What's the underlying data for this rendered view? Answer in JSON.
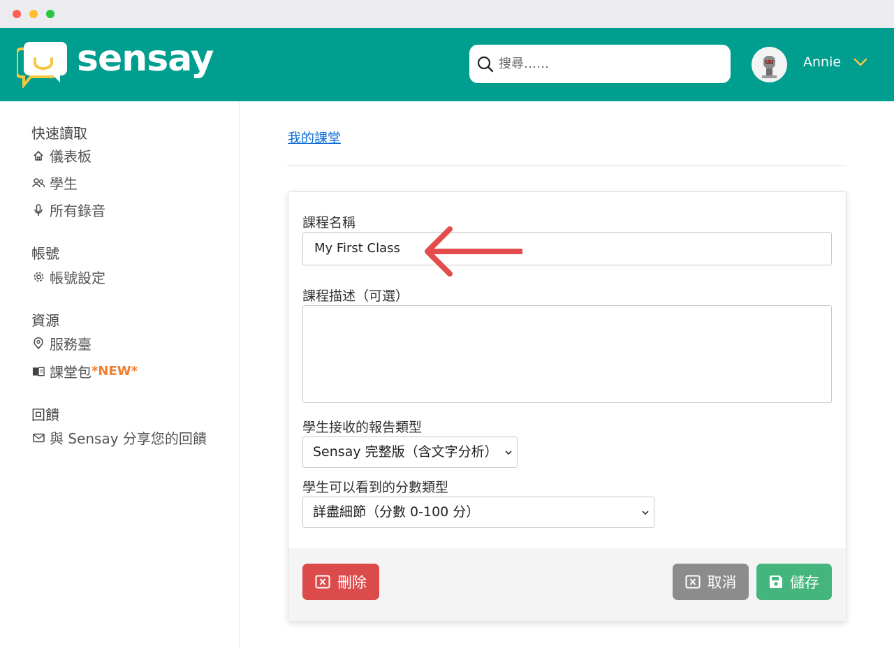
{
  "app": {
    "brand": "sensay",
    "colors": {
      "header": "#009e8f",
      "danger": "#dc4b4b",
      "neutral": "#8c8c8c",
      "success": "#44b57c",
      "accent_new": "#f07e2f",
      "link": "#0b6bd8"
    }
  },
  "header": {
    "search_placeholder": "搜尋……",
    "user_name": "Annie",
    "icons": {
      "search": "search-icon",
      "menu": "chevron-down-icon"
    }
  },
  "sidebar": {
    "sections": [
      {
        "title": "快速讀取",
        "items": [
          {
            "label": "儀表板",
            "icon": "home-icon"
          },
          {
            "label": "學生",
            "icon": "users-icon"
          },
          {
            "label": "所有錄音",
            "icon": "microphone-icon"
          }
        ]
      },
      {
        "title": "帳號",
        "items": [
          {
            "label": "帳號設定",
            "icon": "gear-icon"
          }
        ]
      },
      {
        "title": "資源",
        "items": [
          {
            "label": "服務臺",
            "icon": "help-icon"
          },
          {
            "label": "課堂包",
            "badge": "*NEW*",
            "icon": "book-icon"
          }
        ]
      },
      {
        "title": "回饋",
        "items": [
          {
            "label": "與 Sensay 分享您的回饋",
            "icon": "mail-icon"
          }
        ]
      }
    ]
  },
  "main": {
    "breadcrumb": "我的課堂",
    "form": {
      "name_label": "課程名稱",
      "name_value": "My First Class",
      "desc_label": "課程描述（可選）",
      "desc_value": "",
      "report_label": "學生接收的報告類型",
      "report_value": "Sensay 完整版（含文字分析）",
      "score_label": "學生可以看到的分數類型",
      "score_value": "詳盡細節（分數 0-100 分）"
    },
    "buttons": {
      "delete": "刪除",
      "cancel": "取消",
      "save": "儲存"
    }
  }
}
